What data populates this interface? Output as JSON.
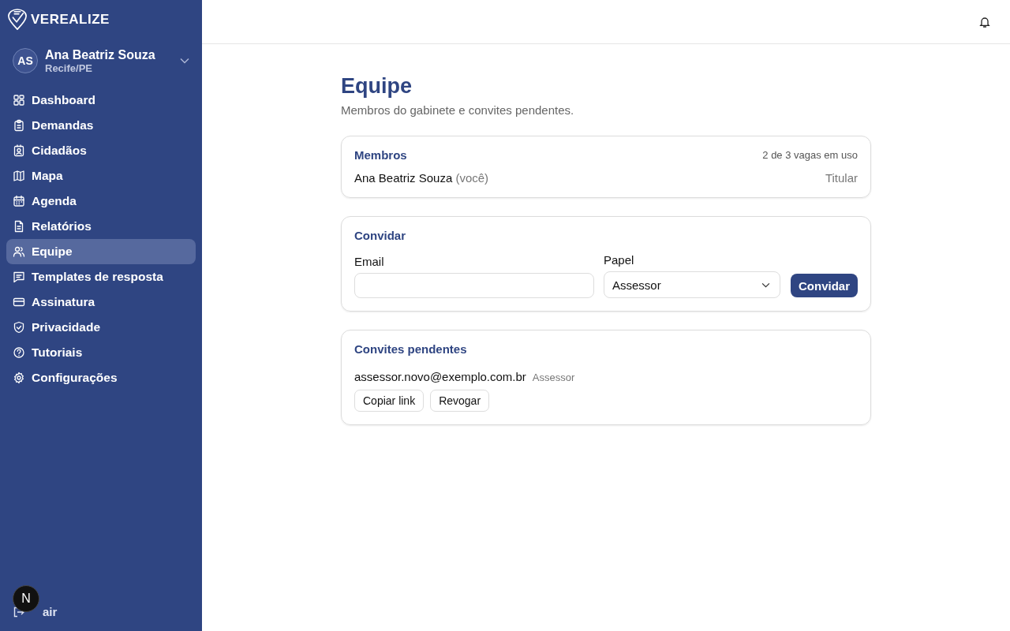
{
  "brand": {
    "name": "VEREALIZE"
  },
  "user": {
    "initials": "AS",
    "name": "Ana Beatriz Souza",
    "location": "Recife/PE"
  },
  "nav": [
    {
      "label": "Dashboard",
      "kind": "grid",
      "selected": false
    },
    {
      "label": "Demandas",
      "kind": "clipboard",
      "selected": false
    },
    {
      "label": "Cidadãos",
      "kind": "contact",
      "selected": false
    },
    {
      "label": "Mapa",
      "kind": "map",
      "selected": false
    },
    {
      "label": "Agenda",
      "kind": "calendar",
      "selected": false
    },
    {
      "label": "Relatórios",
      "kind": "file",
      "selected": false
    },
    {
      "label": "Equipe",
      "kind": "users",
      "selected": true
    },
    {
      "label": "Templates de resposta",
      "kind": "message",
      "selected": false
    },
    {
      "label": "Assinatura",
      "kind": "card",
      "selected": false
    },
    {
      "label": "Privacidade",
      "kind": "shield",
      "selected": false
    },
    {
      "label": "Tutoriais",
      "kind": "help",
      "selected": false
    },
    {
      "label": "Configurações",
      "kind": "gear",
      "selected": false
    }
  ],
  "logout": {
    "label": "air"
  },
  "dev_badge": {
    "label": "N"
  },
  "page": {
    "title": "Equipe",
    "subtitle": "Membros do gabinete e convites pendentes."
  },
  "members": {
    "title": "Membros",
    "usage": "2 de 3 vagas em uso",
    "rows": [
      {
        "name": "Ana Beatriz Souza",
        "note": "(você)",
        "role": "Titular"
      }
    ]
  },
  "invite": {
    "title": "Convidar",
    "email_label": "Email",
    "role_label": "Papel",
    "role_value": "Assessor",
    "button": "Convidar"
  },
  "pending": {
    "title": "Convites pendentes",
    "rows": [
      {
        "email": "assessor.novo@exemplo.com.br",
        "role": "Assessor",
        "actions": [
          "Copiar link",
          "Revogar"
        ]
      }
    ]
  }
}
